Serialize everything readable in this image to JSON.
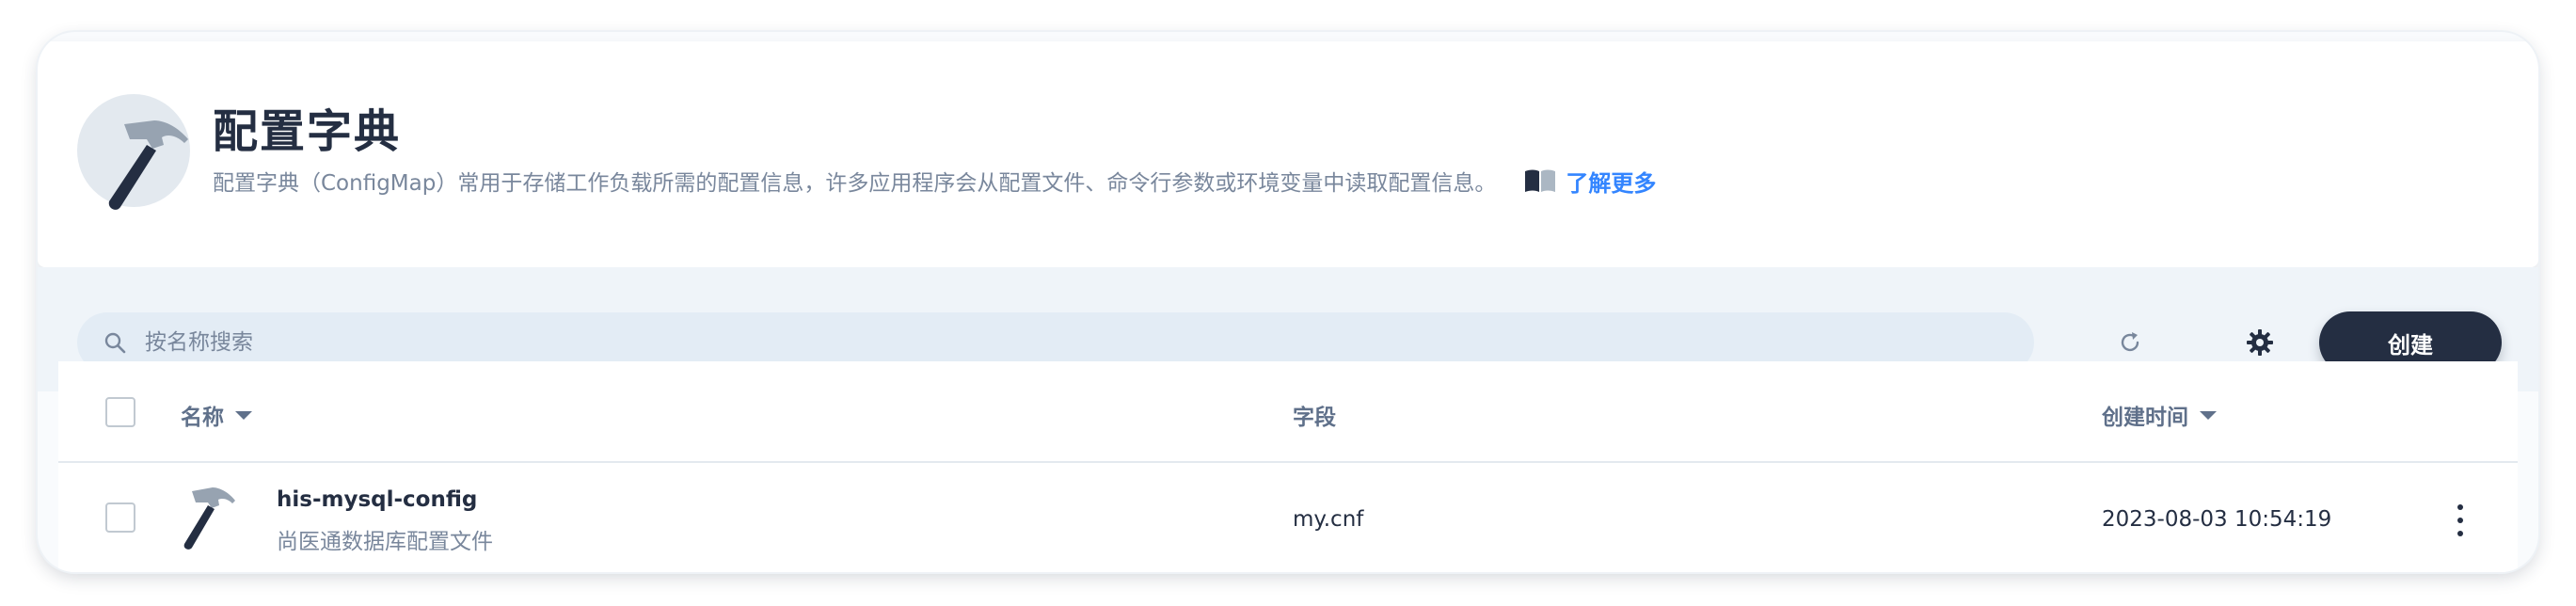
{
  "banner": {
    "title": "配置字典",
    "description": "配置字典（ConfigMap）常用于存储工作负载所需的配置信息，许多应用程序会从配置文件、命令行参数或环境变量中读取配置信息。",
    "learn_more": "了解更多",
    "icon": "hammer-icon"
  },
  "toolbar": {
    "search_placeholder": "按名称搜索",
    "create_label": "创建",
    "icons": [
      "search-icon",
      "refresh-icon",
      "gear-icon"
    ]
  },
  "table": {
    "columns": [
      "名称",
      "字段",
      "创建时间"
    ],
    "rows": [
      {
        "name": "his-mysql-config",
        "description": "尚医通数据库配置文件",
        "field": "my.cnf",
        "created": "2023-08-03 10:54:19"
      }
    ]
  },
  "colors": {
    "accent": "#3385ff",
    "primary_dark": "#242e42",
    "muted_text": "#79879c"
  }
}
